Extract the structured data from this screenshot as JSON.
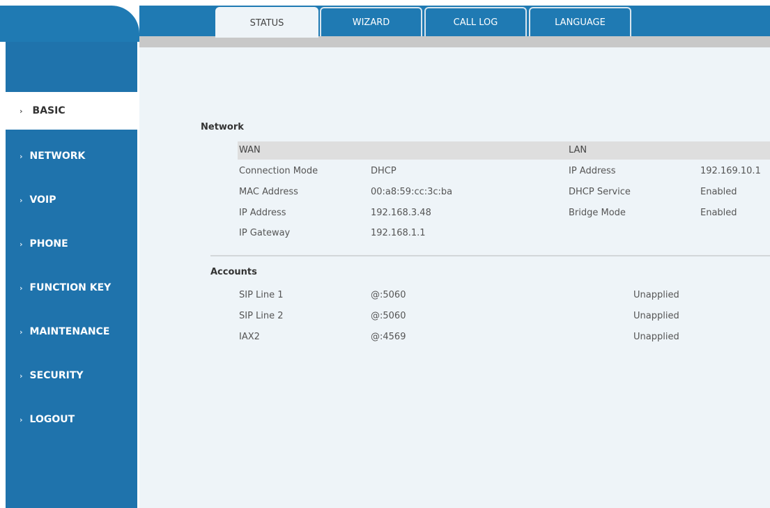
{
  "tabs": [
    {
      "label": "STATUS",
      "active": true
    },
    {
      "label": "WIZARD",
      "active": false
    },
    {
      "label": "CALL LOG",
      "active": false
    },
    {
      "label": "LANGUAGE",
      "active": false
    }
  ],
  "sidebar": {
    "items": [
      {
        "label": "BASIC"
      },
      {
        "label": "NETWORK"
      },
      {
        "label": "VOIP"
      },
      {
        "label": "PHONE"
      },
      {
        "label": "FUNCTION KEY"
      },
      {
        "label": "MAINTENANCE"
      },
      {
        "label": "SECURITY"
      },
      {
        "label": "LOGOUT"
      }
    ]
  },
  "network": {
    "title": "Network",
    "wan_header": "WAN",
    "lan_header": "LAN",
    "wan_rows": [
      {
        "label": "Connection Mode",
        "value": "DHCP"
      },
      {
        "label": "MAC Address",
        "value": "00:a8:59:cc:3c:ba"
      },
      {
        "label": "IP Address",
        "value": "192.168.3.48"
      },
      {
        "label": "IP Gateway",
        "value": "192.168.1.1"
      }
    ],
    "lan_rows": [
      {
        "label": "IP Address",
        "value": "192.169.10.1"
      },
      {
        "label": "DHCP Service",
        "value": "Enabled"
      },
      {
        "label": "Bridge Mode",
        "value": "Enabled"
      }
    ]
  },
  "accounts": {
    "title": "Accounts",
    "rows": [
      {
        "name": "SIP Line 1",
        "address": "@:5060",
        "status": "Unapplied"
      },
      {
        "name": "SIP Line 2",
        "address": "@:5060",
        "status": "Unapplied"
      },
      {
        "name": "IAX2",
        "address": "@:4569",
        "status": "Unapplied"
      }
    ]
  },
  "colors": {
    "brand_blue": "#1f7ab3",
    "sidebar_blue": "#1f73ac",
    "content_bg": "#eef4f8"
  }
}
